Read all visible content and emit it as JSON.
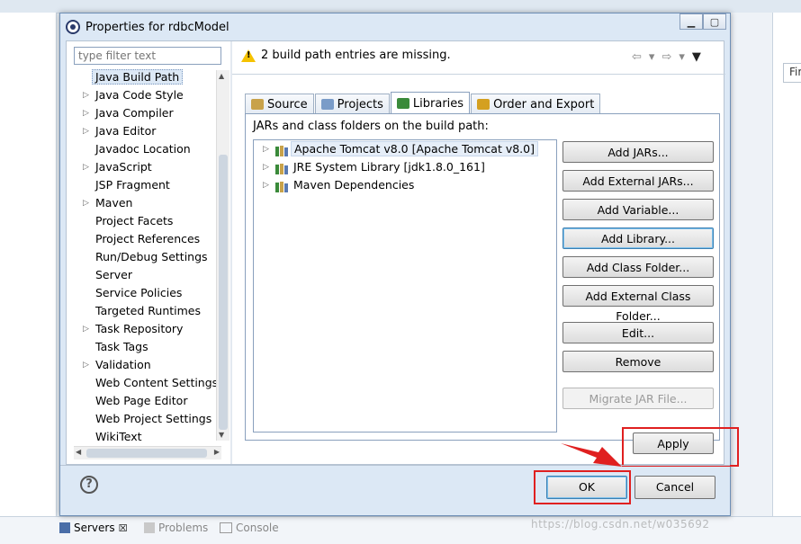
{
  "dialog": {
    "title": "Properties for rdbcModel",
    "filter_placeholder": "type filter text",
    "message": "2 build path entries are missing."
  },
  "tree": {
    "items": [
      {
        "label": "Java Build Path",
        "arrow": "",
        "selected": true
      },
      {
        "label": "Java Code Style",
        "arrow": "▷"
      },
      {
        "label": "Java Compiler",
        "arrow": "▷"
      },
      {
        "label": "Java Editor",
        "arrow": "▷"
      },
      {
        "label": "Javadoc Location",
        "arrow": ""
      },
      {
        "label": "JavaScript",
        "arrow": "▷"
      },
      {
        "label": "JSP Fragment",
        "arrow": ""
      },
      {
        "label": "Maven",
        "arrow": "▷"
      },
      {
        "label": "Project Facets",
        "arrow": ""
      },
      {
        "label": "Project References",
        "arrow": ""
      },
      {
        "label": "Run/Debug Settings",
        "arrow": ""
      },
      {
        "label": "Server",
        "arrow": ""
      },
      {
        "label": "Service Policies",
        "arrow": ""
      },
      {
        "label": "Targeted Runtimes",
        "arrow": ""
      },
      {
        "label": "Task Repository",
        "arrow": "▷"
      },
      {
        "label": "Task Tags",
        "arrow": ""
      },
      {
        "label": "Validation",
        "arrow": "▷"
      },
      {
        "label": "Web Content Settings",
        "arrow": ""
      },
      {
        "label": "Web Page Editor",
        "arrow": ""
      },
      {
        "label": "Web Project Settings",
        "arrow": ""
      },
      {
        "label": "WikiText",
        "arrow": ""
      }
    ]
  },
  "tabs": [
    {
      "label": "Source",
      "icon": "folder-icon",
      "color": "#c8a24a"
    },
    {
      "label": "Projects",
      "icon": "projects-icon",
      "color": "#7a9cc8"
    },
    {
      "label": "Libraries",
      "icon": "library-icon",
      "color": "#3a8a3a",
      "active": true
    },
    {
      "label": "Order and Export",
      "icon": "order-icon",
      "color": "#d4a020"
    }
  ],
  "libraries": {
    "label": "JARs and class folders on the build path:",
    "items": [
      {
        "label": "Apache Tomcat v8.0 [Apache Tomcat v8.0]",
        "selected": true
      },
      {
        "label": "JRE System Library [jdk1.8.0_161]"
      },
      {
        "label": "Maven Dependencies"
      }
    ]
  },
  "buttons": {
    "add_jars": "Add JARs...",
    "add_external_jars": "Add External JARs...",
    "add_variable": "Add Variable...",
    "add_library": "Add Library...",
    "add_class_folder": "Add Class Folder...",
    "add_external_class_folder": "Add External Class Folder...",
    "edit": "Edit...",
    "remove": "Remove",
    "migrate_jar": "Migrate JAR File...",
    "apply": "Apply",
    "ok": "OK",
    "cancel": "Cancel"
  },
  "background": {
    "right_input": "Fir",
    "bottom_tabs": [
      {
        "label": "Servers",
        "active": true
      },
      {
        "label": "Problems"
      },
      {
        "label": "Console"
      }
    ],
    "watermark": "https://blog.csdn.net/w035692"
  },
  "colors": {
    "highlight_red": "#e02020",
    "warning": "#f5c200",
    "focus_blue": "#3c7fb1"
  }
}
